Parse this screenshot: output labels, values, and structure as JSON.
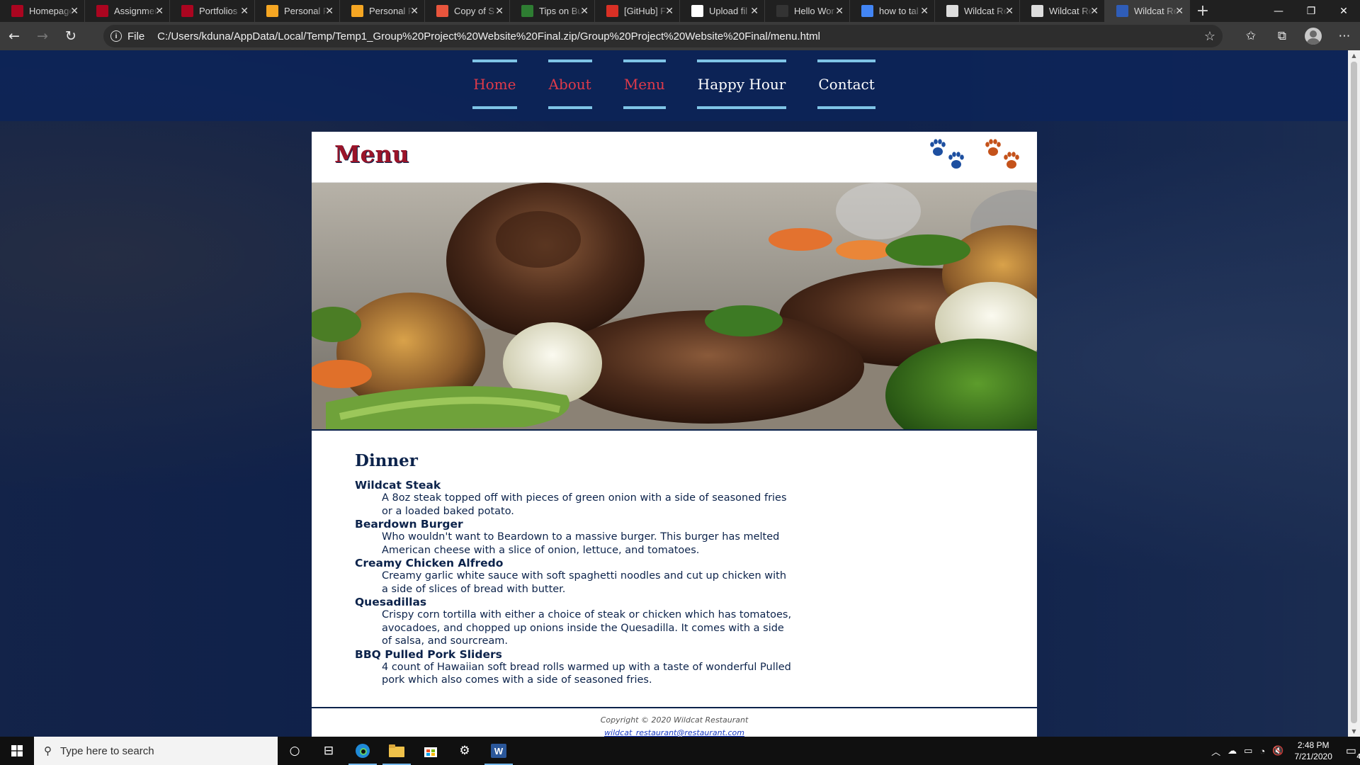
{
  "browser": {
    "tabs": [
      {
        "title": "Homepage",
        "icon": "arizona-a-icon",
        "color": "#ab0520"
      },
      {
        "title": "Assignments",
        "icon": "arizona-a-icon",
        "color": "#ab0520"
      },
      {
        "title": "Portfolios",
        "icon": "portfolio-icon",
        "color": "#ab0520"
      },
      {
        "title": "Personal F",
        "icon": "lightning-icon",
        "color": "#f5a623"
      },
      {
        "title": "Personal F",
        "icon": "lightning-icon",
        "color": "#f5a623"
      },
      {
        "title": "Copy of S",
        "icon": "copy-icon",
        "color": "#e8553d"
      },
      {
        "title": "Tips on Bu",
        "icon": "dollar-icon",
        "color": "#2e7d32"
      },
      {
        "title": "[GitHub] F",
        "icon": "gmail-icon",
        "color": "#d93025"
      },
      {
        "title": "Upload fil",
        "icon": "github-icon",
        "color": "#ffffff"
      },
      {
        "title": "Hello Wor",
        "icon": "github-icon",
        "color": "#333333"
      },
      {
        "title": "how to tal",
        "icon": "google-icon",
        "color": "#4285f4"
      },
      {
        "title": "Wildcat Re",
        "icon": "file-icon",
        "color": "#dddddd"
      },
      {
        "title": "Wildcat Re",
        "icon": "file-icon",
        "color": "#dddddd"
      },
      {
        "title": "Wildcat Re",
        "icon": "paw-icon",
        "color": "#2f5db8"
      }
    ],
    "active_tab_index": 13,
    "address_scheme": "File",
    "url": "C:/Users/kduna/AppData/Local/Temp/Temp1_Group%20Project%20Website%20Final.zip/Group%20Project%20Website%20Final/menu.html"
  },
  "site": {
    "nav": [
      {
        "label": "Home",
        "color": "#e03a4a"
      },
      {
        "label": "About",
        "color": "#e03a4a"
      },
      {
        "label": "Menu",
        "color": "#e03a4a"
      },
      {
        "label": "Happy Hour",
        "color": "#ffffff"
      },
      {
        "label": "Contact",
        "color": "#ffffff"
      }
    ],
    "page_title": "Menu",
    "paw_colors": [
      "#1d4fa0",
      "#c4521a"
    ],
    "section_heading": "Dinner",
    "dishes": [
      {
        "name": "Wildcat Steak",
        "description": "A 8oz steak topped off with pieces of green onion with a side of seasoned fries or a loaded baked potato."
      },
      {
        "name": "Beardown Burger",
        "description": "Who wouldn't want to Beardown to a massive burger. This burger has melted American cheese with a slice of onion, lettuce, and tomatoes."
      },
      {
        "name": "Creamy Chicken Alfredo",
        "description": "Creamy garlic white sauce with soft spaghetti noodles and cut up chicken with a side of slices of bread with butter."
      },
      {
        "name": "Quesadillas",
        "description": "Crispy corn tortilla with either a choice of steak or chicken which has tomatoes, avocadoes, and chopped up onions inside the Quesadilla. It comes with a side of salsa, and sourcream."
      },
      {
        "name": "BBQ Pulled Pork Sliders",
        "description": "4 count of Hawaiian soft bread rolls warmed up with a taste of wonderful Pulled pork which also comes with a side of seasoned fries."
      }
    ],
    "footer": {
      "copyright": "Copyright © 2020 Wildcat Restaurant",
      "email": "wildcat_restaurant@restaurant.com"
    }
  },
  "taskbar": {
    "search_placeholder": "Type here to search",
    "time": "2:48 PM",
    "date": "7/21/2020",
    "notification_count": "4"
  }
}
